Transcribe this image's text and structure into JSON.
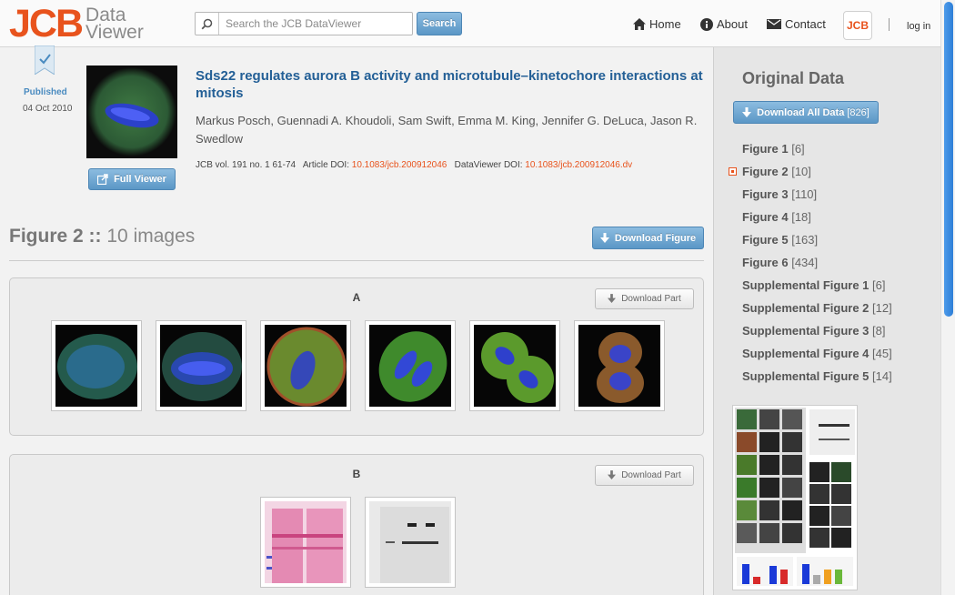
{
  "header": {
    "logo_main": "JCB",
    "logo_sub_line1": "Data",
    "logo_sub_line2": "Viewer",
    "search_placeholder": "Search the JCB DataViewer",
    "search_button": "Search",
    "nav": [
      {
        "label": "Home",
        "icon": "home-icon"
      },
      {
        "label": "About",
        "icon": "info-icon"
      },
      {
        "label": "Contact",
        "icon": "envelope-icon"
      }
    ],
    "badge": "JCB",
    "login": "log in"
  },
  "article": {
    "status": "Published",
    "date": "04 Oct 2010",
    "title": "Sds22 regulates aurora B activity and microtubule–kinetochore interactions at mitosis",
    "authors": "Markus Posch, Guennadi A. Khoudoli, Sam Swift, Emma M. King, Jennifer G. DeLuca, Jason R. Swedlow",
    "journal": "JCB vol. 191 no. 1 61-74",
    "article_doi_label": "Article DOI:",
    "article_doi": "10.1083/jcb.200912046",
    "dataviewer_doi_label": "DataViewer DOI:",
    "dataviewer_doi": "10.1083/jcb.200912046.dv",
    "full_viewer_button": "Full Viewer"
  },
  "figure": {
    "name": "Figure 2",
    "separator": "::",
    "images_text": "10 images",
    "download_button": "Download Figure",
    "parts": [
      {
        "label": "A",
        "download": "Download Part"
      },
      {
        "label": "B",
        "download": "Download Part"
      }
    ]
  },
  "sidebar": {
    "title": "Original Data",
    "download_all": "Download All Data",
    "download_all_count": "[826]",
    "active_index": 1,
    "figures": [
      {
        "label": "Figure 1",
        "count": "[6]"
      },
      {
        "label": "Figure 2",
        "count": "[10]"
      },
      {
        "label": "Figure 3",
        "count": "[110]"
      },
      {
        "label": "Figure 4",
        "count": "[18]"
      },
      {
        "label": "Figure 5",
        "count": "[163]"
      },
      {
        "label": "Figure 6",
        "count": "[434]"
      },
      {
        "label": "Supplemental Figure 1",
        "count": "[6]"
      },
      {
        "label": "Supplemental Figure 2",
        "count": "[12]"
      },
      {
        "label": "Supplemental Figure 3",
        "count": "[8]"
      },
      {
        "label": "Supplemental Figure 4",
        "count": "[45]"
      },
      {
        "label": "Supplemental Figure 5",
        "count": "[14]"
      }
    ]
  },
  "colors": {
    "brand_orange": "#e8531d",
    "link_blue": "#235f96",
    "button_blue": "#5b97c6",
    "scroll_blue": "#2d7fd7"
  }
}
